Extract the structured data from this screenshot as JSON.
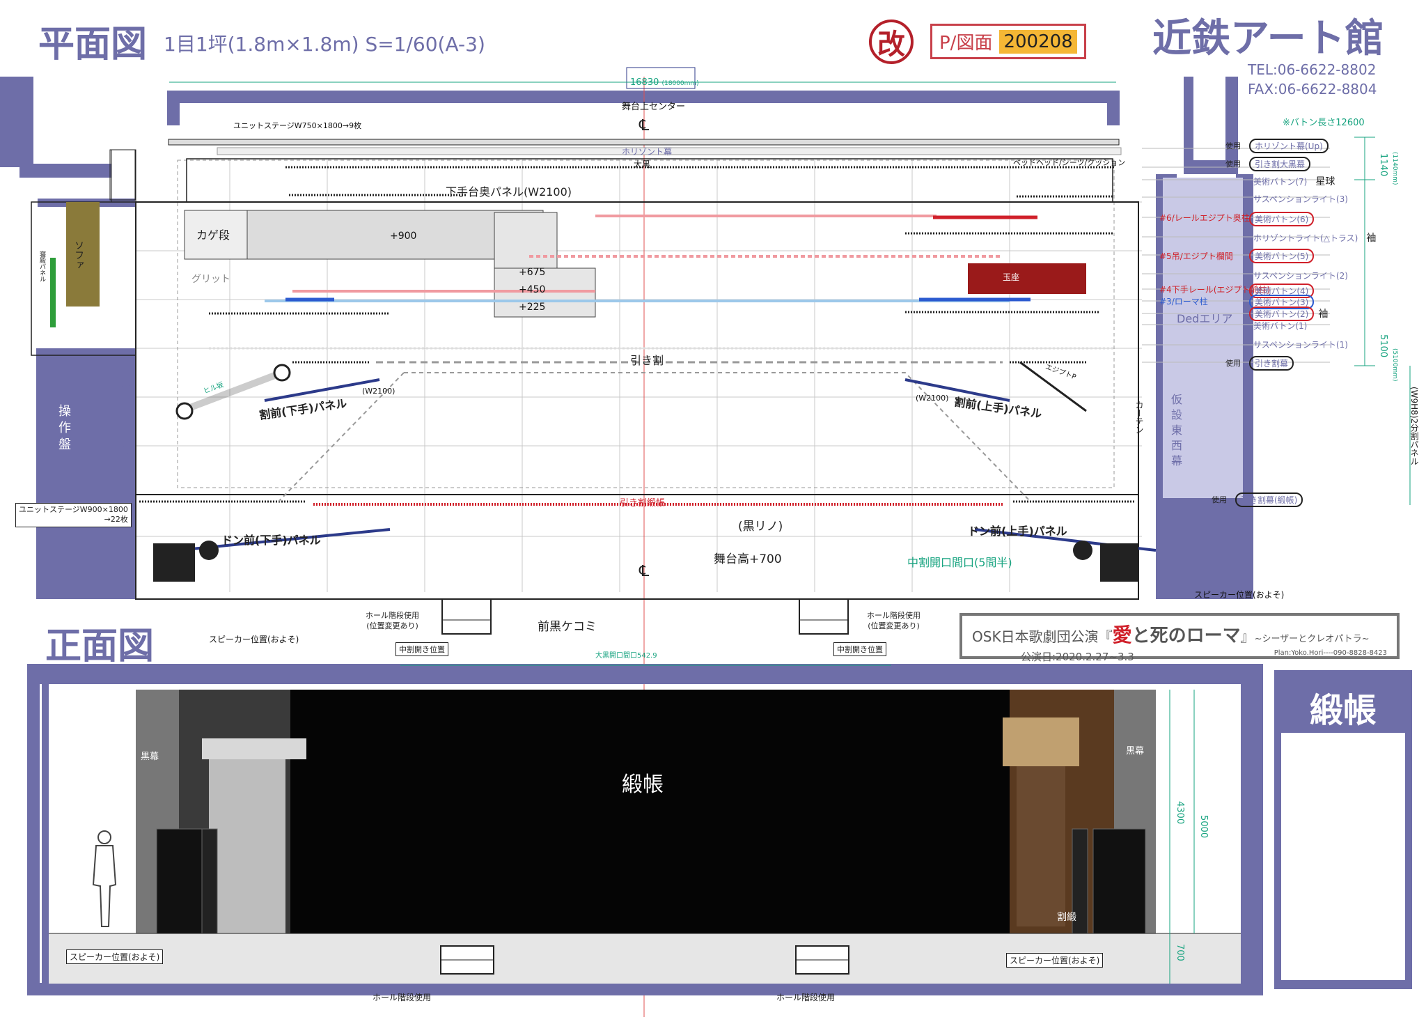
{
  "header": {
    "plan_title": "平面図",
    "plan_subtitle": "1目1坪(1.8m×1.8m)  S=1/60(A-3)",
    "revised_mark": "改",
    "drawing_label": "P/図面",
    "drawing_date": "200208",
    "venue": "近鉄アート館",
    "tel": "TEL:06-6622-8802",
    "fax": "FAX:06-6622-8804"
  },
  "plan": {
    "width_dim": "16830",
    "width_dim_mm": "(18000mm)",
    "stage_center": "舞台上センター",
    "cl_mark": "℄",
    "unit_stage_top": "ユニットステージW750×1800→9枚",
    "horizont": "ホリゾント幕",
    "ookuro": "大黒",
    "bed_label": "ベッドヘッド/シーツ/クッション",
    "shimote_back_panel": "下手台奥パネル(W2100)",
    "kage_dan": "カゲ段",
    "plus900": "+900",
    "plus675": "+675",
    "plus450": "+450",
    "plus225": "+225",
    "grid": "グリット",
    "sofa": "ソファ",
    "side_panel": "寝殿パネル",
    "throne": "玉座",
    "hikiwari": "引き割",
    "waripae_shimote": "割前(下手)パネル",
    "waripae_kamite": "割前(上手)パネル",
    "w2100_left": "(W2100)",
    "w2100_right": "(W2100)",
    "slope_left": "ヒル坂",
    "slope_right": "エジプトP",
    "kasetsu": "仮設東西幕",
    "control": "操作盤",
    "curtain": "カーテン",
    "ded_area": "Dedエリア",
    "hikiwari_mid": "引き割緞帳",
    "kuro_rino": "(黒リノ)",
    "stage_height": "舞台高+700",
    "naka_opening": "中割開口間口(5間半)",
    "don_shimote": "ドン前(下手)パネル",
    "don_kamite": "ドン前(上手)パネル",
    "unit_stage_bottom": "ユニットステージW900×1800",
    "unit_stage_bottom2": "→22枚",
    "speaker_right": "スピーカー位置(およそ)",
    "speaker_left": "スピーカー位置(およそ)",
    "hall_stairs_l1": "ホール階段使用",
    "hall_stairs_l2": "(位置変更あり)",
    "hall_stairs_r1": "ホール階段使用",
    "hall_stairs_r2": "(位置変更あり)",
    "mae_kuro": "前黒ケコミ",
    "rail_6": "#6/レールエジプト奥柱",
    "rail_5": "#5吊/エジプト欄間",
    "rail_4": "#4下手レール(エジプト前柱)",
    "rail_3": "#3/ローマ柱",
    "baton_note": "※バトン長さ12600",
    "dim_1140": "1140",
    "dim_1140mm": "(1140mm)",
    "dim_5100": "5100",
    "dim_5100mm": "(5100mm)",
    "dim_side": "(W9H8)2分割パネル"
  },
  "battens": [
    {
      "use": "使用",
      "label": "ホリゾント幕(Up)",
      "extra": ""
    },
    {
      "use": "使用",
      "label": "引き割大黒幕",
      "extra": ""
    },
    {
      "use": "",
      "label": "美術バトン(7)",
      "extra": "星球"
    },
    {
      "use": "",
      "label": "サスペンションライト(3)",
      "extra": ""
    },
    {
      "use": "",
      "label": "美術バトン(6)",
      "extra": ""
    },
    {
      "use": "",
      "label": "ホリゾントライト(△トラス)",
      "extra": "袖"
    },
    {
      "use": "",
      "label": "美術バトン(5)",
      "extra": ""
    },
    {
      "use": "",
      "label": "サスペンションライト(2)",
      "extra": ""
    },
    {
      "use": "",
      "label": "美術バトン(4)",
      "extra": ""
    },
    {
      "use": "",
      "label": "美術バトン(3)",
      "extra": ""
    },
    {
      "use": "",
      "label": "美術バトン(2)",
      "extra": "袖"
    },
    {
      "use": "",
      "label": "美術バトン(1)",
      "extra": ""
    },
    {
      "use": "",
      "label": "サスペンションライト(1)",
      "extra": ""
    },
    {
      "use": "使用",
      "label": "引き割幕",
      "extra": ""
    },
    {
      "use": "使用",
      "label": "引き割幕(緞帳)",
      "extra": ""
    }
  ],
  "elevation": {
    "title": "正面図",
    "naka_left": "中割開き位置",
    "naka_right": "中割開き位置",
    "ookuro_open": "大黒開口間口542.9",
    "kuromaku_left": "黒幕",
    "kuromaku_right": "黒幕",
    "donchou": "緞帳",
    "warichou": "割緞",
    "dim_4300": "4300",
    "dim_5000": "5000",
    "dim_700": "700",
    "speaker_left": "スピーカー位置(およそ)",
    "speaker_right": "スピーカー位置(およそ)",
    "hall_stairs_left": "ホール階段使用",
    "hall_stairs_right": "ホール階段使用"
  },
  "show": {
    "company": "OSK日本歌劇団公演",
    "quote_open": "『",
    "title_ai": "愛",
    "title_rest": "と死のローマ",
    "quote_close": "』",
    "subtitle": "~シーザーとクレオパトラ~",
    "dates": "公演日:2020.2.27~3.3",
    "planner": "Plan:Yoko.Hori----090-8828-8423"
  },
  "side_box": {
    "title": "緞帳"
  },
  "colors": {
    "wall": "#6e6ea8",
    "accent_red": "#d0202a",
    "accent_blue": "#2c5bd0",
    "highlight": "#f5b735",
    "ded": "#c9c9e6"
  }
}
